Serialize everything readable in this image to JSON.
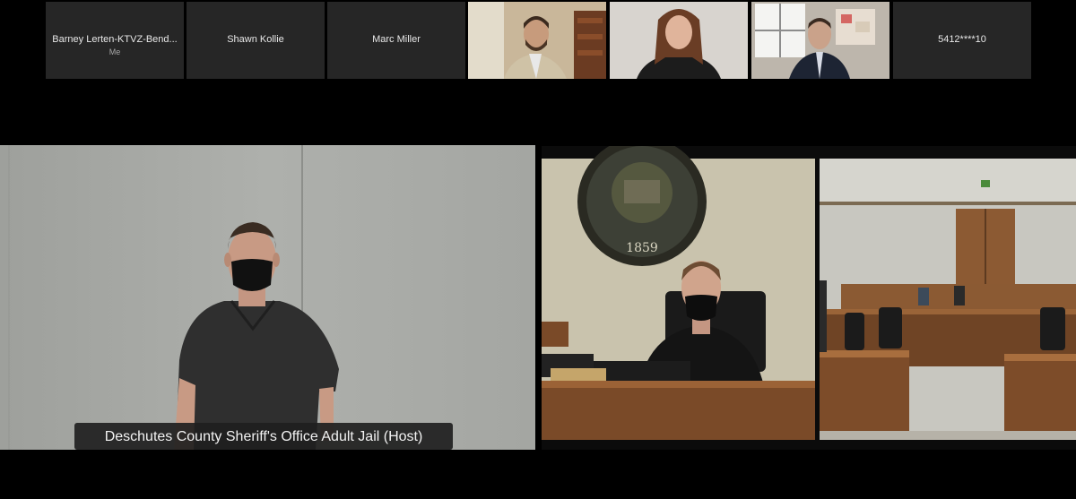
{
  "participants": [
    {
      "name": "Barney Lerten-KTVZ-Bend...",
      "sub": "Me",
      "video": false
    },
    {
      "name": "Shawn Kollie",
      "sub": "",
      "video": false
    },
    {
      "name": "Marc Miller",
      "sub": "",
      "video": false
    },
    {
      "name": "",
      "video": true
    },
    {
      "name": "",
      "video": true
    },
    {
      "name": "",
      "video": true
    },
    {
      "name": "5412****10",
      "sub": "",
      "video": false
    }
  ],
  "main_video": {
    "label": "Deschutes County Sheriff's Office Adult Jail (Host)"
  },
  "shared_screen": {
    "seal_year": "1859"
  }
}
